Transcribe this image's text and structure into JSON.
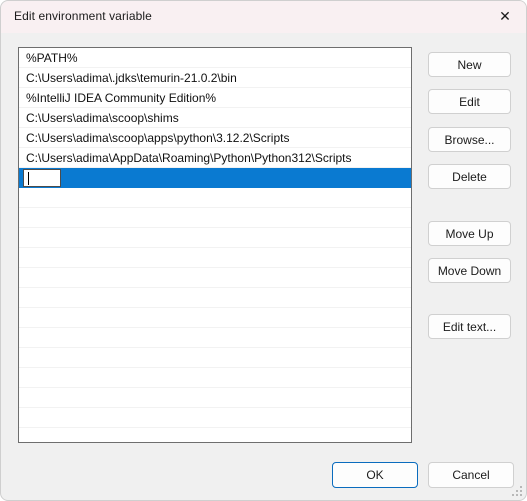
{
  "window": {
    "title": "Edit environment variable",
    "close_icon": "close-icon",
    "close_glyph": "✕",
    "titlebar_color": "#f9f0f2",
    "body_color": "#f0f0f0"
  },
  "list": {
    "selection_color": "#0a7ad1",
    "total_visible_rows": 19,
    "items": [
      {
        "text": "%PATH%",
        "selected": false
      },
      {
        "text": "C:\\Users\\adima\\.jdks\\temurin-21.0.2\\bin",
        "selected": false
      },
      {
        "text": "%IntelliJ IDEA Community Edition%",
        "selected": false
      },
      {
        "text": "C:\\Users\\adima\\scoop\\shims",
        "selected": false
      },
      {
        "text": "C:\\Users\\adima\\scoop\\apps\\python\\3.12.2\\Scripts",
        "selected": false
      },
      {
        "text": "C:\\Users\\adima\\AppData\\Roaming\\Python\\Python312\\Scripts",
        "selected": false
      }
    ],
    "editing_row": {
      "value": "",
      "placeholder": "",
      "selected": true,
      "has_caret": true
    }
  },
  "side_buttons": [
    {
      "id": "new",
      "label": "New"
    },
    {
      "id": "edit",
      "label": "Edit"
    },
    {
      "id": "browse",
      "label": "Browse..."
    },
    {
      "id": "delete",
      "label": "Delete"
    },
    {
      "id": "move_up",
      "label": "Move Up"
    },
    {
      "id": "move_down",
      "label": "Move Down"
    },
    {
      "id": "edit_text",
      "label": "Edit text..."
    }
  ],
  "bottom_buttons": {
    "ok": "OK",
    "cancel": "Cancel",
    "default_button": "ok",
    "focus_color": "#0a6cbe"
  },
  "resize_grip_icon": "resize-grip-icon"
}
